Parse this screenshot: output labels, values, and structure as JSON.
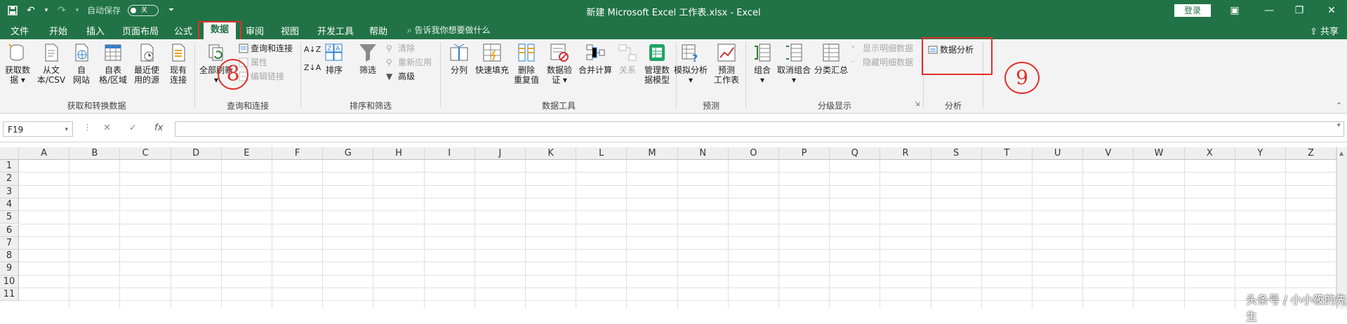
{
  "titlebar": {
    "autosave_label": "自动保存",
    "toggle_state": "关",
    "window_title": "新建 Microsoft Excel 工作表.xlsx  -  Excel",
    "login_label": "登录"
  },
  "tabs": [
    "文件",
    "开始",
    "插入",
    "页面布局",
    "公式",
    "数据",
    "审阅",
    "视图",
    "开发工具",
    "帮助"
  ],
  "active_tab": "数据",
  "tell_me": "告诉我你想要做什么",
  "share_label": "共享",
  "ribbon": {
    "get_transform": {
      "label": "获取和转换数据",
      "buttons": [
        {
          "l1": "获取数",
          "l2": "据 ▾"
        },
        {
          "l1": "从文",
          "l2": "本/CSV"
        },
        {
          "l1": "自",
          "l2": "网站"
        },
        {
          "l1": "自表",
          "l2": "格/区域"
        },
        {
          "l1": "最近使",
          "l2": "用的源"
        },
        {
          "l1": "现有",
          "l2": "连接"
        }
      ]
    },
    "queries": {
      "label": "查询和连接",
      "refresh_all": "全部刷新",
      "small": [
        "查询和连接",
        "属性",
        "编辑链接"
      ]
    },
    "sort_filter": {
      "label": "排序和筛选",
      "sort": "排序",
      "filter": "筛选",
      "small": [
        "清除",
        "重新应用",
        "高级"
      ]
    },
    "data_tools": {
      "label": "数据工具",
      "buttons": [
        {
          "l1": "分列",
          "l2": ""
        },
        {
          "l1": "快速填充",
          "l2": ""
        },
        {
          "l1": "删除",
          "l2": "重复值"
        },
        {
          "l1": "数据验",
          "l2": "证 ▾"
        },
        {
          "l1": "合并计算",
          "l2": ""
        },
        {
          "l1": "关系",
          "l2": ""
        },
        {
          "l1": "管理数",
          "l2": "据模型"
        }
      ]
    },
    "forecast": {
      "label": "预测",
      "whatif": "模拟分析",
      "forecast_sheet_l1": "预测",
      "forecast_sheet_l2": "工作表"
    },
    "outline": {
      "label": "分级显示",
      "group": "组合",
      "ungroup": "取消组合",
      "subtotal": "分类汇总",
      "show_detail": "显示明细数据",
      "hide_detail": "隐藏明细数据"
    },
    "analysis": {
      "label": "分析",
      "data_analysis": "数据分析"
    }
  },
  "annotations": {
    "circle8": "8",
    "circle9": "9"
  },
  "formula_bar": {
    "name_box": "F19",
    "formula": ""
  },
  "columns": [
    "A",
    "B",
    "C",
    "D",
    "E",
    "F",
    "G",
    "H",
    "I",
    "J",
    "K",
    "L",
    "M",
    "N",
    "O",
    "P",
    "Q",
    "R",
    "S",
    "T",
    "U",
    "V",
    "W",
    "X",
    "Y",
    "Z"
  ],
  "rows": [
    "1",
    "2",
    "3",
    "4",
    "5",
    "6",
    "7",
    "8",
    "9",
    "10",
    "11"
  ],
  "watermark": "头条号 / 小小筱的先生",
  "colors": {
    "excel_green": "#217346",
    "annotation_red": "#e0302a"
  }
}
